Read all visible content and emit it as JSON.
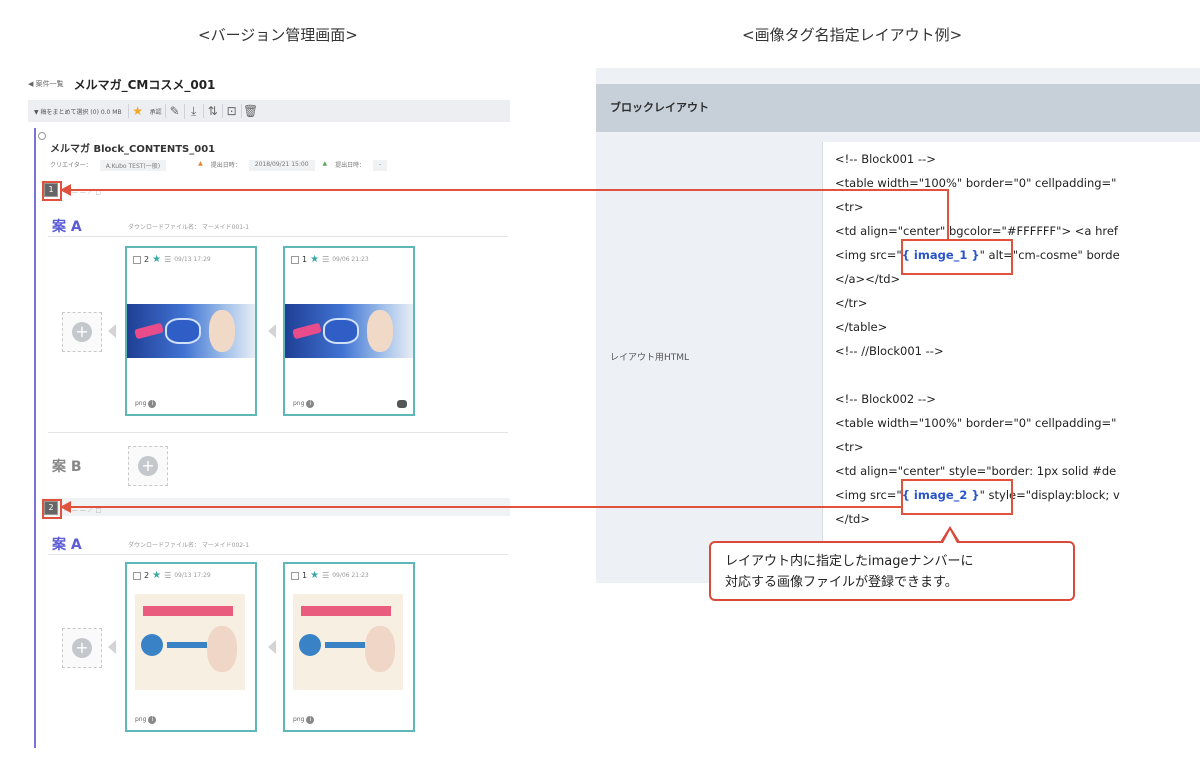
{
  "captions": {
    "left": "<バージョン管理画面>",
    "right": "<画像タグ名指定レイアウト例>"
  },
  "left_panel": {
    "back_link": "◀ 案件一覧",
    "project_title": "メルマガ_CMコスメ_001",
    "toolbar": {
      "bulk_select": "▼ 稿をまとめて選択 (0) 0.0 MB",
      "approve_label": "承認"
    },
    "block": {
      "name": "メルマガ Block_CONTENTS_001",
      "creator_label": "クリエイター：",
      "creator_value": "A.Kubo TEST(一般)",
      "submit_label": "提出日時：",
      "submit_value": "2018/09/21 15:00",
      "deadline_label": "提出日時：",
      "deadline_value": "-"
    },
    "slots": [
      {
        "number": "1",
        "plans": [
          {
            "label": "案 A",
            "download_text": "ダウンロードファイル名： マーメイド001-1",
            "cards": [
              {
                "version": "2",
                "date": "09/13 17:29",
                "format": "png"
              },
              {
                "version": "1",
                "date": "09/06 21:23",
                "format": "png"
              }
            ]
          },
          {
            "label": "案 B"
          }
        ]
      },
      {
        "number": "2",
        "plans": [
          {
            "label": "案 A",
            "download_text": "ダウンロードファイル名： マーメイド002-1",
            "cards": [
              {
                "version": "2",
                "date": "09/13 17:29",
                "format": "png"
              },
              {
                "version": "1",
                "date": "09/06 21:23",
                "format": "png"
              }
            ]
          }
        ]
      }
    ]
  },
  "right_panel": {
    "header": "ブロックレイアウト",
    "html_label": "レイアウト用HTML",
    "code_lines": [
      "<!-- Block001 -->",
      "<table width=\"100%\" border=\"0\" cellpadding=\"",
      "<tr>",
      "<td align=\"center\" bgcolor=\"#FFFFFF\"> <a href",
      "<img src=\"",
      "{ image_1 }",
      "\" alt=\"cm-cosme\" borde",
      "</a></td>",
      "</tr>",
      "</table>",
      "<!-- //Block001 -->",
      "<!-- Block002 -->",
      "<table width=\"100%\" border=\"0\" cellpadding=\"",
      "<tr>",
      "<td align=\"center\" style=\"border: 1px solid #de",
      "<img src=\"",
      "{ image_2 }",
      "\" style=\"display:block; v",
      "</td>"
    ]
  },
  "callout": {
    "line1": "レイアウト内に指定したimageナンバーに",
    "line2": "対応する画像ファイルが登録できます。"
  },
  "colors": {
    "accent_purple": "#5b5bd6",
    "card_border": "#5fb8b8",
    "annotation_red": "#e1523d",
    "code_tag_blue": "#2855cc"
  }
}
